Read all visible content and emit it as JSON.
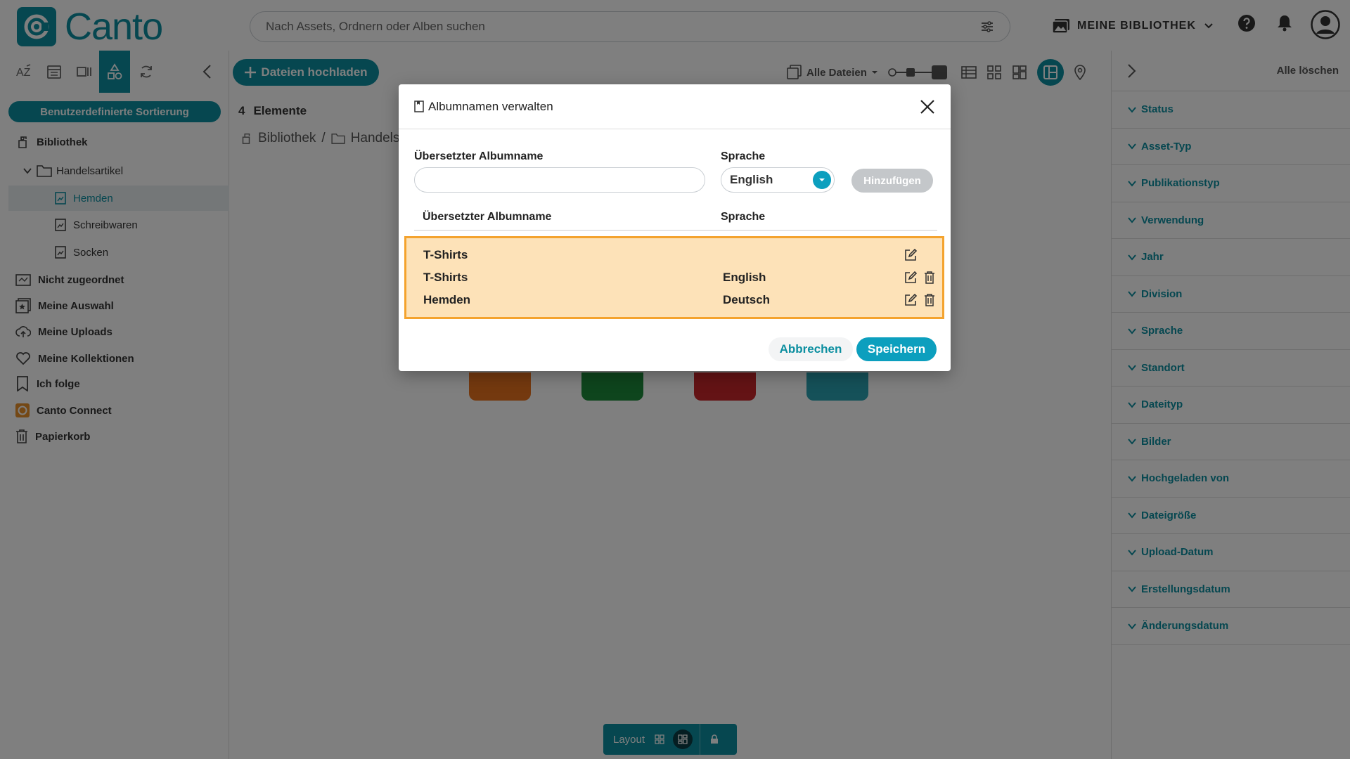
{
  "app": {
    "name": "Canto"
  },
  "header": {
    "search_placeholder": "Nach Assets, Ordnern oder Alben suchen",
    "library_label": "MEINE BIBLIOTHEK"
  },
  "sidebar": {
    "sort_label": "Benutzerdefinierte Sortierung",
    "tree": {
      "library": "Bibliothek",
      "folder": "Handelsartikel",
      "albums": [
        "Hemden",
        "Schreibwaren",
        "Socken"
      ]
    },
    "items": [
      "Nicht zugeordnet",
      "Meine Auswahl",
      "Meine Uploads",
      "Meine Kollektionen",
      "Ich folge",
      "Canto Connect",
      "Papierkorb"
    ]
  },
  "main": {
    "upload_label": "Dateien hochladen",
    "filter_label": "Alle Dateien",
    "count": "4",
    "count_label": "Elemente",
    "breadcrumb": [
      "Bibliothek",
      "Handelsa"
    ],
    "layout_label": "Layout",
    "thumb_colors": [
      "#e8731f",
      "#1d8a3a",
      "#c8262b",
      "#2aa3b3"
    ]
  },
  "filters": {
    "clear_all": "Alle löschen",
    "facets": [
      "Status",
      "Asset-Typ",
      "Publikationstyp",
      "Verwendung",
      "Jahr",
      "Division",
      "Sprache",
      "Standort",
      "Dateityp",
      "Bilder",
      "Hochgeladen von",
      "Dateigröße",
      "Upload-Datum",
      "Erstellungsdatum",
      "Änderungsdatum"
    ]
  },
  "modal": {
    "title": "Albumnamen verwalten",
    "name_label": "Übersetzter Albumname",
    "language_label": "Sprache",
    "name_value": "",
    "language_value": "English",
    "add_label": "Hinzufügen",
    "table_headers": [
      "Übersetzter Albumname",
      "Sprache"
    ],
    "rows": [
      {
        "name": "T-Shirts",
        "language": ""
      },
      {
        "name": "T-Shirts",
        "language": "English"
      },
      {
        "name": "Hemden",
        "language": "Deutsch"
      }
    ],
    "cancel_label": "Abbrechen",
    "save_label": "Speichern"
  },
  "colors": {
    "accent": "#0c8fa0",
    "highlight_border": "#f4a32e",
    "highlight_fill": "#fde2b8"
  }
}
